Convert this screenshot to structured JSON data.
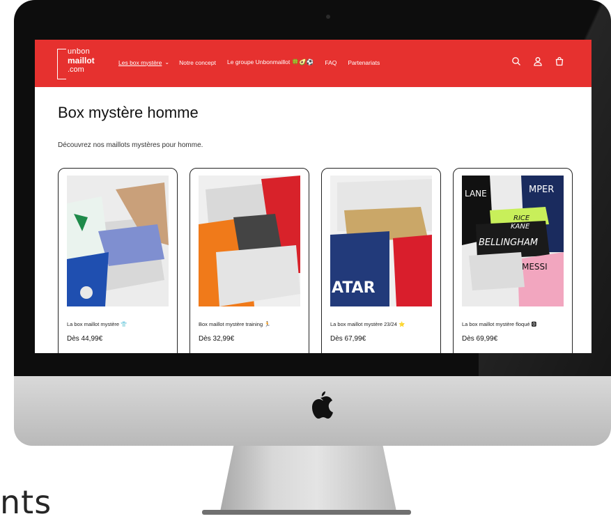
{
  "header": {
    "logo_lines": [
      "unbon",
      "maillot",
      ".com"
    ],
    "nav": [
      {
        "label": "Les box mystère",
        "active": true,
        "dropdown": true
      },
      {
        "label": "Notre concept"
      },
      {
        "label": "Le groupe Unbonmaillot 🍀🥑⚽"
      },
      {
        "label": "FAQ"
      },
      {
        "label": "Partenariats"
      }
    ],
    "icons": [
      "search-icon",
      "account-icon",
      "cart-icon"
    ],
    "bg_color": "#e6312f"
  },
  "main": {
    "title": "Box mystère homme",
    "description": "Découvrez nos maillots mystères pour homme."
  },
  "products": [
    {
      "name": "La box maillot mystère 👕",
      "price": "Dès 44,99€"
    },
    {
      "name": "Box maillot mystère training 🏃",
      "price": "Dès 32,99€"
    },
    {
      "name": "La box maillot mystère 23/24 ⭐",
      "price": "Dès 67,99€"
    },
    {
      "name": "La box maillot mystère floqué 🅾",
      "price": "Dès 69,99€"
    }
  ],
  "jersey_text": [
    "ATAR",
    "RICE",
    "KANE",
    "BELLINGHAM",
    "MESSI",
    "MPER",
    "LANE"
  ],
  "caption": "nts"
}
